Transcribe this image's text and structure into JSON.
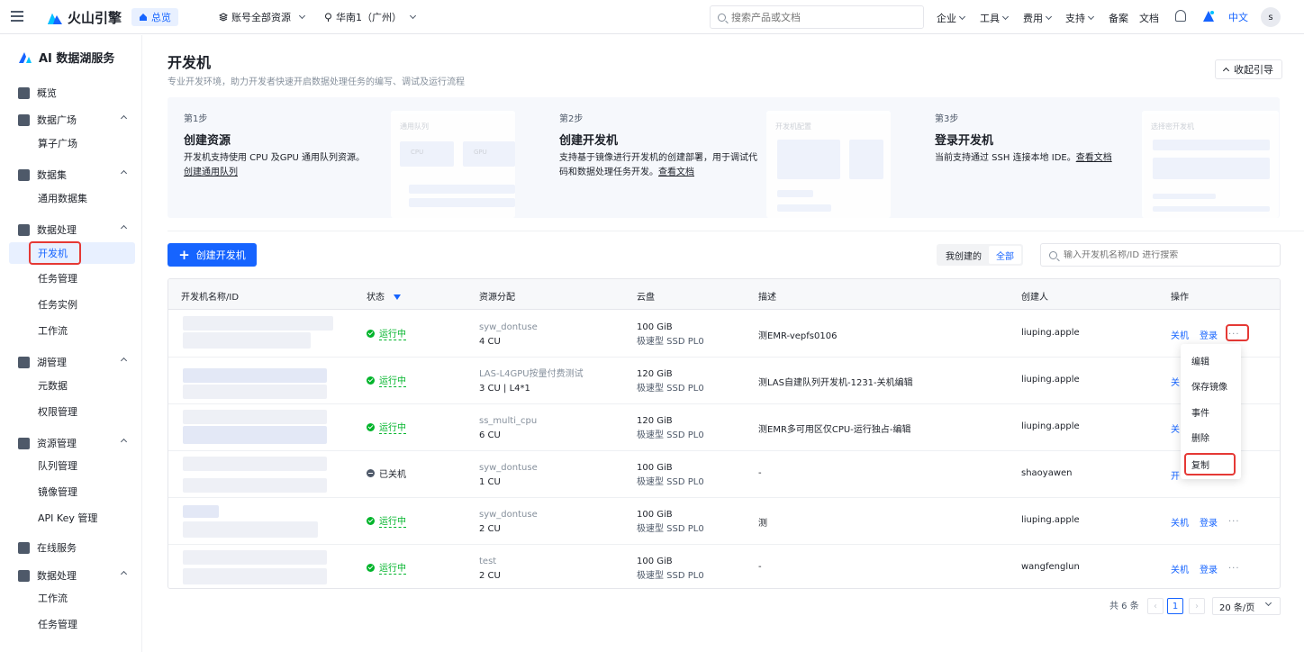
{
  "topbar": {
    "brand": "火山引擎",
    "home": "总览",
    "account_scope": "账号全部资源",
    "region": "华南1（广州）",
    "search_placeholder": "搜索产品或文档",
    "nav": [
      "企业",
      "工具",
      "费用",
      "支持",
      "备案",
      "文档"
    ],
    "lang": "中文",
    "avatar": "s",
    "brand_color": "#1664ff"
  },
  "sidebar": {
    "title": "AI 数据湖服务",
    "groups": [
      {
        "label": "概览",
        "icon": "home-icon"
      },
      {
        "label": "数据广场",
        "icon": "grid-icon",
        "items": [
          "算子广场"
        ]
      },
      {
        "label": "数据集",
        "icon": "layers-icon",
        "items": [
          "通用数据集"
        ]
      },
      {
        "label": "数据处理",
        "icon": "process-icon",
        "items": [
          "开发机",
          "任务管理",
          "任务实例",
          "工作流"
        ]
      },
      {
        "label": "湖管理",
        "icon": "database-icon",
        "items": [
          "元数据",
          "权限管理"
        ]
      },
      {
        "label": "资源管理",
        "icon": "server-icon",
        "items": [
          "队列管理",
          "镜像管理",
          "API Key 管理"
        ]
      },
      {
        "label": "在线服务",
        "icon": "apps-icon"
      },
      {
        "label": "数据处理",
        "icon": "process-icon",
        "items": [
          "工作流",
          "任务管理"
        ]
      }
    ],
    "active_item": "开发机"
  },
  "page": {
    "title": "开发机",
    "subtitle": "专业开发环境，助力开发者快速开启数据处理任务的编写、调试及运行流程",
    "collapse_guide": "收起引导"
  },
  "steps": [
    {
      "no": "第1步",
      "title": "创建资源",
      "desc": "开发机支持使用 CPU 及GPU 通用队列资源。",
      "link": "创建通用队列",
      "ill_title": "通用队列",
      "ill_tags": [
        "CPU",
        "GPU"
      ]
    },
    {
      "no": "第2步",
      "title": "创建开发机",
      "desc": "支持基于镜像进行开发机的创建部署，用于调试代码和数据处理任务开发。",
      "link": "查看文档",
      "ill_title": "开发机配置"
    },
    {
      "no": "第3步",
      "title": "登录开发机",
      "desc": "当前支持通过 SSH 连接本地 IDE。",
      "link": "查看文档",
      "ill_title": "选择密开发机"
    }
  ],
  "toolbar": {
    "create_label": "创建开发机",
    "filter_mine": "我创建的",
    "filter_all": "全部",
    "search_placeholder": "输入开发机名称/ID 进行搜索"
  },
  "table": {
    "headers": [
      "开发机名称/ID",
      "状态",
      "资源分配",
      "云盘",
      "描述",
      "创建人",
      "操作"
    ],
    "rows": [
      {
        "status": "运行中",
        "running": true,
        "queue": "syw_dontuse",
        "cu": "4 CU",
        "disk": "100 GiB",
        "disk_type": "极速型 SSD PL0",
        "desc": "测EMR-vepfs0106",
        "creator": "liuping.apple",
        "ops": [
          "关机",
          "登录"
        ],
        "more": "···"
      },
      {
        "status": "运行中",
        "running": true,
        "queue": "LAS-L4GPU按量付费测试",
        "cu": "3 CU | L4*1",
        "disk": "120 GiB",
        "disk_type": "极速型 SSD PL0",
        "desc": "测LAS自建队列开发机-1231-关机编辑",
        "creator": "liuping.apple",
        "ops": [
          "关"
        ],
        "more": ""
      },
      {
        "status": "运行中",
        "running": true,
        "queue": "ss_multi_cpu",
        "cu": "6 CU",
        "disk": "120 GiB",
        "disk_type": "极速型 SSD PL0",
        "desc": "测EMR多可用区仅CPU-运行独占-编辑",
        "creator": "liuping.apple",
        "ops": [
          "关"
        ],
        "more": ""
      },
      {
        "status": "已关机",
        "running": false,
        "queue": "syw_dontuse",
        "cu": "1 CU",
        "disk": "100 GiB",
        "disk_type": "极速型 SSD PL0",
        "desc": "-",
        "creator": "shaoyawen",
        "ops": [
          "开"
        ],
        "more": ""
      },
      {
        "status": "运行中",
        "running": true,
        "queue": "syw_dontuse",
        "cu": "2 CU",
        "disk": "100 GiB",
        "disk_type": "极速型 SSD PL0",
        "desc": "测",
        "creator": "liuping.apple",
        "ops": [
          "关机",
          "登录"
        ],
        "more": "···"
      },
      {
        "status": "运行中",
        "running": true,
        "queue": "test",
        "cu": "2 CU",
        "disk": "100 GiB",
        "disk_type": "极速型 SSD PL0",
        "desc": "-",
        "creator": "wangfenglun",
        "ops": [
          "关机",
          "登录"
        ],
        "more": "···"
      }
    ]
  },
  "more_menu": [
    "编辑",
    "保存镜像",
    "事件",
    "删除",
    "复制"
  ],
  "pagination": {
    "total": "共 6 条",
    "current": "1",
    "page_size": "20 条/页"
  }
}
